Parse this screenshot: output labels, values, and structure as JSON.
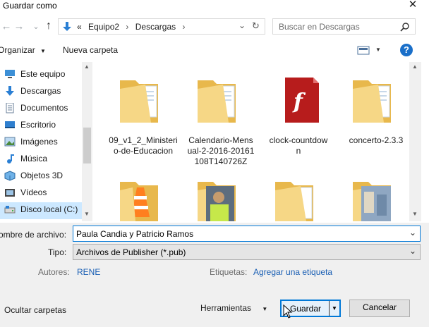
{
  "window": {
    "title": "Guardar como",
    "close_glyph": "✕"
  },
  "nav": {
    "back_glyph": "←",
    "forward_glyph": "→",
    "up_glyph": "↑",
    "breadcrumb": [
      "«",
      "Equipo2",
      "Descargas"
    ],
    "breadcrumb_sep": "›",
    "history_glyph": "⌄",
    "refresh_glyph": "↻",
    "search_placeholder": "Buscar en Descargas"
  },
  "toolbar": {
    "organize": "Organizar",
    "new_folder": "Nueva carpeta",
    "help": "?"
  },
  "tree": [
    {
      "label": "Este equipo",
      "icon": "computer-icon"
    },
    {
      "label": "Descargas",
      "icon": "download-icon"
    },
    {
      "label": "Documentos",
      "icon": "documents-icon"
    },
    {
      "label": "Escritorio",
      "icon": "desktop-icon"
    },
    {
      "label": "Imágenes",
      "icon": "pictures-icon"
    },
    {
      "label": "Música",
      "icon": "music-icon"
    },
    {
      "label": "Objetos 3D",
      "icon": "objects3d-icon"
    },
    {
      "label": "Vídeos",
      "icon": "videos-icon"
    },
    {
      "label": "Disco local (C:)",
      "icon": "drive-icon"
    }
  ],
  "files": [
    {
      "line1": "09_v1_2_Ministeri",
      "line2": "o-de-Educacion",
      "line3": "",
      "type": "folder"
    },
    {
      "line1": "Calendario-Mens",
      "line2": "ual-2-2016-20161",
      "line3": "108T140726Z",
      "type": "folder"
    },
    {
      "line1": "clock-countdow",
      "line2": "n",
      "line3": "",
      "type": "flash"
    },
    {
      "line1": "concerto-2.3.3",
      "line2": "",
      "line3": "",
      "type": "folder"
    }
  ],
  "form": {
    "filename_label": "ombre de archivo:",
    "filename_value": "Paula Candia y Patricio Ramos",
    "type_label": "Tipo:",
    "type_value": "Archivos de Publisher (*.pub)",
    "authors_label": "Autores:",
    "authors_value": "RENE",
    "tags_label": "Etiquetas:",
    "tags_value": "Agregar una etiqueta"
  },
  "footer": {
    "hide_folders": "Ocultar carpetas",
    "tools": "Herramientas",
    "save": "Guardar",
    "cancel": "Cancelar"
  },
  "colors": {
    "accent": "#0078d7",
    "selection": "#cce8ff",
    "folder": "#f4d27a",
    "link": "#1a5fb4"
  }
}
